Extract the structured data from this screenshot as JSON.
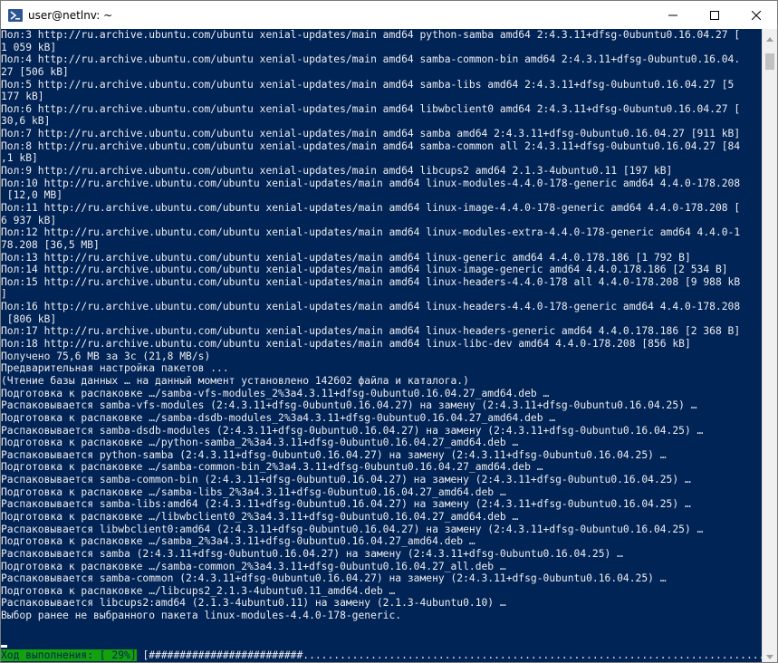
{
  "window": {
    "title": "user@netlnv: ~",
    "controls": [
      "minimize",
      "maximize",
      "close"
    ]
  },
  "colors": {
    "terminal_bg": "#012456",
    "terminal_fg": "#eeedf0",
    "progress_label_bg": "#13a10e",
    "titlebar_bg": "#ffffff"
  },
  "terminal": {
    "lines": [
      "Пол:3 http://ru.archive.ubuntu.com/ubuntu xenial-updates/main amd64 python-samba amd64 2:4.3.11+dfsg-0ubuntu0.16.04.27 [",
      "1 059 kB]",
      "Пол:4 http://ru.archive.ubuntu.com/ubuntu xenial-updates/main amd64 samba-common-bin amd64 2:4.3.11+dfsg-0ubuntu0.16.04.",
      "27 [506 kB]",
      "Пол:5 http://ru.archive.ubuntu.com/ubuntu xenial-updates/main amd64 samba-libs amd64 2:4.3.11+dfsg-0ubuntu0.16.04.27 [5",
      "177 kB]",
      "Пол:6 http://ru.archive.ubuntu.com/ubuntu xenial-updates/main amd64 libwbclient0 amd64 2:4.3.11+dfsg-0ubuntu0.16.04.27 [",
      "30,6 kB]",
      "Пол:7 http://ru.archive.ubuntu.com/ubuntu xenial-updates/main amd64 samba amd64 2:4.3.11+dfsg-0ubuntu0.16.04.27 [911 kB]",
      "Пол:8 http://ru.archive.ubuntu.com/ubuntu xenial-updates/main amd64 samba-common all 2:4.3.11+dfsg-0ubuntu0.16.04.27 [84",
      ",1 kB]",
      "Пол:9 http://ru.archive.ubuntu.com/ubuntu xenial-updates/main amd64 libcups2 amd64 2.1.3-4ubuntu0.11 [197 kB]",
      "Пол:10 http://ru.archive.ubuntu.com/ubuntu xenial-updates/main amd64 linux-modules-4.4.0-178-generic amd64 4.4.0-178.208",
      " [12,0 MB]",
      "Пол:11 http://ru.archive.ubuntu.com/ubuntu xenial-updates/main amd64 linux-image-4.4.0-178-generic amd64 4.4.0-178.208 [",
      "6 937 kB]",
      "Пол:12 http://ru.archive.ubuntu.com/ubuntu xenial-updates/main amd64 linux-modules-extra-4.4.0-178-generic amd64 4.4.0-1",
      "78.208 [36,5 MB]",
      "Пол:13 http://ru.archive.ubuntu.com/ubuntu xenial-updates/main amd64 linux-generic amd64 4.4.0.178.186 [1 792 B]",
      "Пол:14 http://ru.archive.ubuntu.com/ubuntu xenial-updates/main amd64 linux-image-generic amd64 4.4.0.178.186 [2 534 B]",
      "Пол:15 http://ru.archive.ubuntu.com/ubuntu xenial-updates/main amd64 linux-headers-4.4.0-178 all 4.4.0-178.208 [9 988 kB",
      "]",
      "Пол:16 http://ru.archive.ubuntu.com/ubuntu xenial-updates/main amd64 linux-headers-4.4.0-178-generic amd64 4.4.0-178.208",
      " [806 kB]",
      "Пол:17 http://ru.archive.ubuntu.com/ubuntu xenial-updates/main amd64 linux-headers-generic amd64 4.4.0.178.186 [2 368 B]",
      "Пол:18 http://ru.archive.ubuntu.com/ubuntu xenial-updates/main amd64 linux-libc-dev amd64 4.4.0-178.208 [856 kB]",
      "Получено 75,6 MB за 3с (21,8 MB/s)",
      "Предварительная настройка пакетов ...",
      "(Чтение базы данных … на данный момент установлено 142602 файла и каталога.)",
      "Подготовка к распаковке …/samba-vfs-modules_2%3a4.3.11+dfsg-0ubuntu0.16.04.27_amd64.deb …",
      "Распаковывается samba-vfs-modules (2:4.3.11+dfsg-0ubuntu0.16.04.27) на замену (2:4.3.11+dfsg-0ubuntu0.16.04.25) …",
      "Подготовка к распаковке …/samba-dsdb-modules_2%3a4.3.11+dfsg-0ubuntu0.16.04.27_amd64.deb …",
      "Распаковывается samba-dsdb-modules (2:4.3.11+dfsg-0ubuntu0.16.04.27) на замену (2:4.3.11+dfsg-0ubuntu0.16.04.25) …",
      "Подготовка к распаковке …/python-samba_2%3a4.3.11+dfsg-0ubuntu0.16.04.27_amd64.deb …",
      "Распаковывается python-samba (2:4.3.11+dfsg-0ubuntu0.16.04.27) на замену (2:4.3.11+dfsg-0ubuntu0.16.04.25) …",
      "Подготовка к распаковке …/samba-common-bin_2%3a4.3.11+dfsg-0ubuntu0.16.04.27_amd64.deb …",
      "Распаковывается samba-common-bin (2:4.3.11+dfsg-0ubuntu0.16.04.27) на замену (2:4.3.11+dfsg-0ubuntu0.16.04.25) …",
      "Подготовка к распаковке …/samba-libs_2%3a4.3.11+dfsg-0ubuntu0.16.04.27_amd64.deb …",
      "Распаковывается samba-libs:amd64 (2:4.3.11+dfsg-0ubuntu0.16.04.27) на замену (2:4.3.11+dfsg-0ubuntu0.16.04.25) …",
      "Подготовка к распаковке …/libwbclient0_2%3a4.3.11+dfsg-0ubuntu0.16.04.27_amd64.deb …",
      "Распаковывается libwbclient0:amd64 (2:4.3.11+dfsg-0ubuntu0.16.04.27) на замену (2:4.3.11+dfsg-0ubuntu0.16.04.25) …",
      "Подготовка к распаковке …/samba_2%3a4.3.11+dfsg-0ubuntu0.16.04.27_amd64.deb …",
      "Распаковывается samba (2:4.3.11+dfsg-0ubuntu0.16.04.27) на замену (2:4.3.11+dfsg-0ubuntu0.16.04.25) …",
      "Подготовка к распаковке …/samba-common_2%3a4.3.11+dfsg-0ubuntu0.16.04.27_all.deb …",
      "Распаковывается samba-common (2:4.3.11+dfsg-0ubuntu0.16.04.27) на замену (2:4.3.11+dfsg-0ubuntu0.16.04.25) …",
      "Подготовка к распаковке …/libcups2_2.1.3-4ubuntu0.11_amd64.deb …",
      "Распаковывается libcups2:amd64 (2.1.3-4ubuntu0.11) на замену (2.1.3-4ubuntu0.10) …",
      "Выбор ранее не выбранного пакета linux-modules-4.4.0-178-generic."
    ],
    "progress": {
      "label": "Ход выполнения: [ 29%]",
      "bar": " [#########################.............................................................................................]",
      "percent": 29
    }
  }
}
